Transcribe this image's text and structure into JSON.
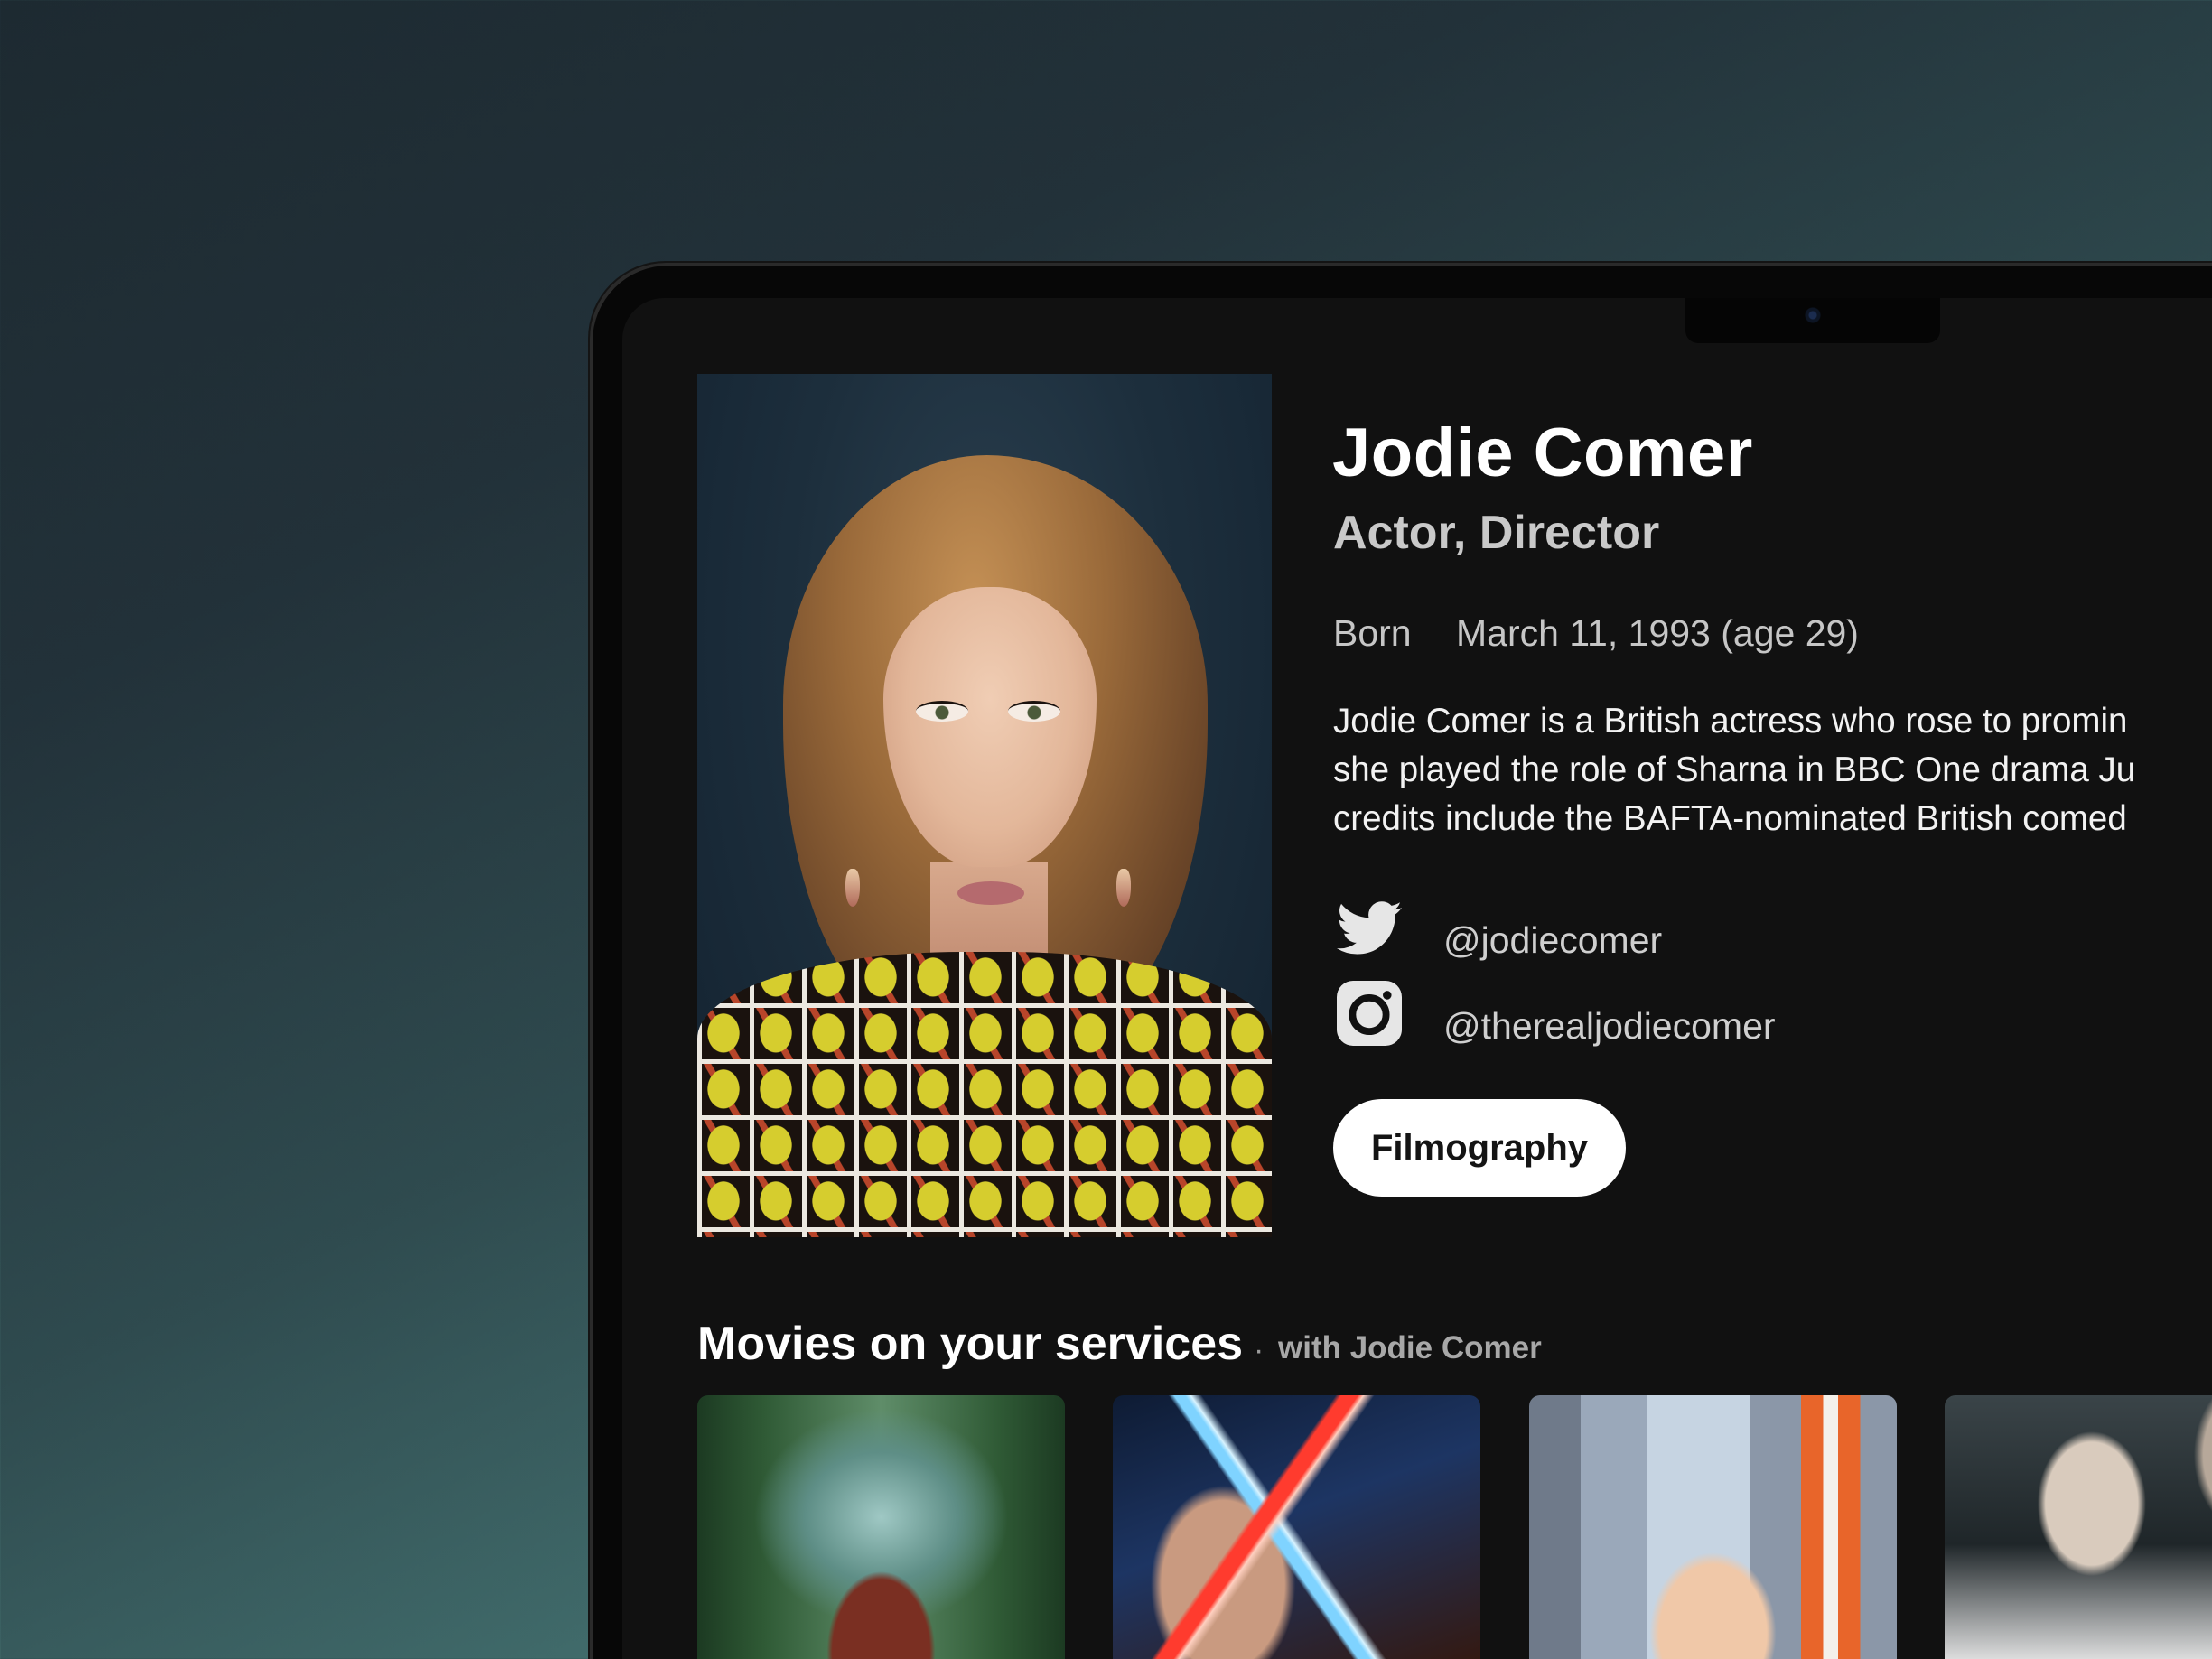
{
  "person": {
    "name": "Jodie Comer",
    "roles": "Actor, Director",
    "born_label": "Born",
    "born_value": "March 11, 1993 (age 29)",
    "bio_lines": [
      "Jodie Comer is a British actress who rose to promin",
      "she played the role of Sharna in BBC One drama Ju",
      "credits include the BAFTA-nominated British comed"
    ],
    "portrait_icon": "person-portrait"
  },
  "social": {
    "twitter": {
      "icon": "twitter-icon",
      "handle": "@jodiecomer"
    },
    "instagram": {
      "icon": "instagram-icon",
      "handle": "@therealjodiecomer"
    }
  },
  "actions": {
    "filmography_label": "Filmography"
  },
  "section": {
    "title": "Movies on your services",
    "separator": "·",
    "subtitle": "with Jodie Comer",
    "posters": [
      "movie-poster",
      "movie-poster",
      "movie-poster",
      "movie-poster"
    ]
  },
  "colors": {
    "background": "#111111",
    "text_primary": "#ffffff",
    "text_secondary": "#c9c9c9",
    "button_bg": "#ffffff",
    "button_text": "#141414"
  }
}
